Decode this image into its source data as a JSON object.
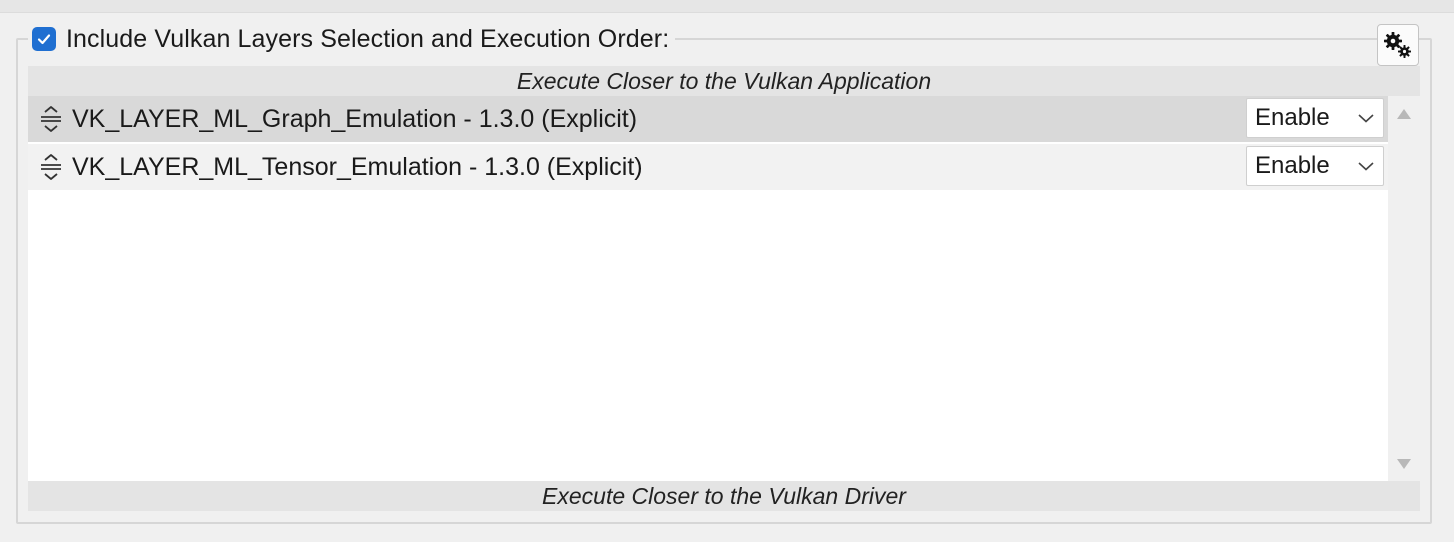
{
  "group": {
    "title": "Include Vulkan Layers Selection and Execution Order:",
    "checked": true
  },
  "order_labels": {
    "top": "Execute Closer to the Vulkan Application",
    "bottom": "Execute Closer to the Vulkan Driver"
  },
  "layers": [
    {
      "name": "VK_LAYER_ML_Graph_Emulation - 1.3.0 (Explicit)",
      "mode": "Enable",
      "selected": true
    },
    {
      "name": "VK_LAYER_ML_Tensor_Emulation - 1.3.0 (Explicit)",
      "mode": "Enable",
      "selected": false
    }
  ],
  "icons": {
    "checkbox": "checkbox-checked-icon",
    "settings": "gears-icon",
    "drag": "drag-handle-icon",
    "dropdown": "chevron-down-icon",
    "scroll_up": "triangle-up-icon",
    "scroll_down": "triangle-down-icon"
  },
  "colors": {
    "accent": "#1f6fd1",
    "selected_row": "#d9d9d9",
    "header_band": "#e4e4e4"
  }
}
